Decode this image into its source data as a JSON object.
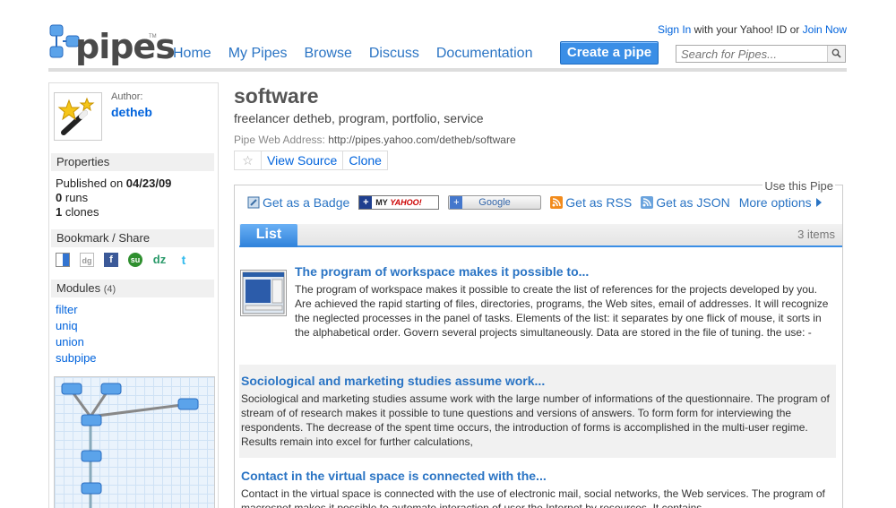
{
  "header": {
    "logo_text": "pipes",
    "logo_tm": "TM",
    "nav": [
      "Home",
      "My Pipes",
      "Browse",
      "Discuss",
      "Documentation"
    ],
    "sign_in": "Sign In",
    "sign_in_mid": "with your Yahoo! ID or",
    "join_now": "Join Now",
    "create_pipe": "Create a pipe",
    "search_placeholder": "Search for Pipes..."
  },
  "sidebar": {
    "author_label": "Author:",
    "author_name": "detheb",
    "properties_title": "Properties",
    "published_label": "Published on",
    "published_date": "04/23/09",
    "runs_count": "0",
    "runs_label": "runs",
    "clones_count": "1",
    "clones_label": "clones",
    "bookmark_title": "Bookmark / Share",
    "modules_title": "Modules",
    "modules_count": "(4)",
    "modules": [
      "filter",
      "uniq",
      "union",
      "subpipe"
    ]
  },
  "pipe": {
    "title": "software",
    "tags": "freelancer detheb, program, portfolio, service",
    "web_address_label": "Pipe Web Address:",
    "web_address": "http://pipes.yahoo.com/detheb/software",
    "view_source": "View Source",
    "clone": "Clone"
  },
  "use": {
    "label": "Use this Pipe",
    "badge": "Get as a Badge",
    "myyahoo_my": "MY",
    "myyahoo_y": "YAHOO!",
    "google": "Google",
    "rss": "Get as RSS",
    "json": "Get as JSON",
    "more": "More options"
  },
  "list": {
    "tab": "List",
    "count": "3 items",
    "items": [
      {
        "title": "The program of workspace makes it possible to...",
        "body": "The program of workspace makes it possible to create the list of references for the projects developed by you. Are achieved the rapid starting of files, directories, programs, the Web sites, email of addresses. It will recognize the neglected processes in the panel of tasks. Elements of the list: it separates by one flick of mouse, it sorts in the alphabetical order. Govern several projects simultaneously. Data are stored in the file of tuning. the use: -"
      },
      {
        "title": "Sociological and marketing studies assume work...",
        "body": "Sociological and marketing studies assume work with the large number of informations of the questionnaire. The program of stream of of research makes it possible to tune questions and versions of answers. To form form for interviewing the respondents. The decrease of the spent time occurs, the introduction of forms is accomplished in the multi-user regime. Results remain into excel for further calculations,"
      },
      {
        "title": "Contact in the virtual space is connected with the...",
        "body": "Contact in the virtual space is connected with the use of electronic mail, social networks, the Web services. The program of macrosnet makes it possible to automate interaction of user the Internet by resources. It contains"
      }
    ]
  },
  "colors": {
    "link": "#0063dc",
    "accent": "#3a8ee6"
  }
}
